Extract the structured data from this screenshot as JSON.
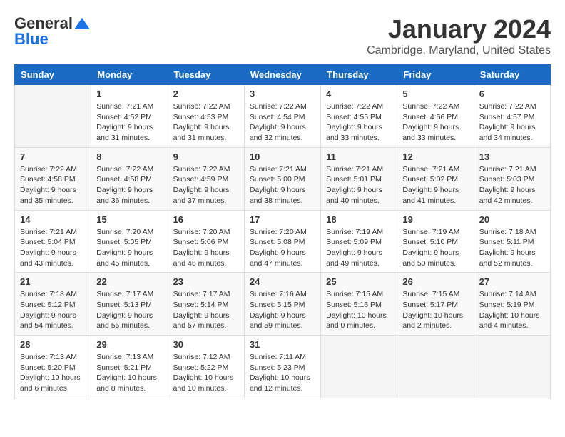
{
  "logo": {
    "line1": "General",
    "line2": "Blue",
    "bird_unicode": "▲"
  },
  "title": "January 2024",
  "subtitle": "Cambridge, Maryland, United States",
  "weekdays": [
    "Sunday",
    "Monday",
    "Tuesday",
    "Wednesday",
    "Thursday",
    "Friday",
    "Saturday"
  ],
  "weeks": [
    [
      {
        "day": "",
        "sunrise": "",
        "sunset": "",
        "daylight": ""
      },
      {
        "day": "1",
        "sunrise": "Sunrise: 7:21 AM",
        "sunset": "Sunset: 4:52 PM",
        "daylight": "Daylight: 9 hours and 31 minutes."
      },
      {
        "day": "2",
        "sunrise": "Sunrise: 7:22 AM",
        "sunset": "Sunset: 4:53 PM",
        "daylight": "Daylight: 9 hours and 31 minutes."
      },
      {
        "day": "3",
        "sunrise": "Sunrise: 7:22 AM",
        "sunset": "Sunset: 4:54 PM",
        "daylight": "Daylight: 9 hours and 32 minutes."
      },
      {
        "day": "4",
        "sunrise": "Sunrise: 7:22 AM",
        "sunset": "Sunset: 4:55 PM",
        "daylight": "Daylight: 9 hours and 33 minutes."
      },
      {
        "day": "5",
        "sunrise": "Sunrise: 7:22 AM",
        "sunset": "Sunset: 4:56 PM",
        "daylight": "Daylight: 9 hours and 33 minutes."
      },
      {
        "day": "6",
        "sunrise": "Sunrise: 7:22 AM",
        "sunset": "Sunset: 4:57 PM",
        "daylight": "Daylight: 9 hours and 34 minutes."
      }
    ],
    [
      {
        "day": "7",
        "sunrise": "Sunrise: 7:22 AM",
        "sunset": "Sunset: 4:58 PM",
        "daylight": "Daylight: 9 hours and 35 minutes."
      },
      {
        "day": "8",
        "sunrise": "Sunrise: 7:22 AM",
        "sunset": "Sunset: 4:58 PM",
        "daylight": "Daylight: 9 hours and 36 minutes."
      },
      {
        "day": "9",
        "sunrise": "Sunrise: 7:22 AM",
        "sunset": "Sunset: 4:59 PM",
        "daylight": "Daylight: 9 hours and 37 minutes."
      },
      {
        "day": "10",
        "sunrise": "Sunrise: 7:21 AM",
        "sunset": "Sunset: 5:00 PM",
        "daylight": "Daylight: 9 hours and 38 minutes."
      },
      {
        "day": "11",
        "sunrise": "Sunrise: 7:21 AM",
        "sunset": "Sunset: 5:01 PM",
        "daylight": "Daylight: 9 hours and 40 minutes."
      },
      {
        "day": "12",
        "sunrise": "Sunrise: 7:21 AM",
        "sunset": "Sunset: 5:02 PM",
        "daylight": "Daylight: 9 hours and 41 minutes."
      },
      {
        "day": "13",
        "sunrise": "Sunrise: 7:21 AM",
        "sunset": "Sunset: 5:03 PM",
        "daylight": "Daylight: 9 hours and 42 minutes."
      }
    ],
    [
      {
        "day": "14",
        "sunrise": "Sunrise: 7:21 AM",
        "sunset": "Sunset: 5:04 PM",
        "daylight": "Daylight: 9 hours and 43 minutes."
      },
      {
        "day": "15",
        "sunrise": "Sunrise: 7:20 AM",
        "sunset": "Sunset: 5:05 PM",
        "daylight": "Daylight: 9 hours and 45 minutes."
      },
      {
        "day": "16",
        "sunrise": "Sunrise: 7:20 AM",
        "sunset": "Sunset: 5:06 PM",
        "daylight": "Daylight: 9 hours and 46 minutes."
      },
      {
        "day": "17",
        "sunrise": "Sunrise: 7:20 AM",
        "sunset": "Sunset: 5:08 PM",
        "daylight": "Daylight: 9 hours and 47 minutes."
      },
      {
        "day": "18",
        "sunrise": "Sunrise: 7:19 AM",
        "sunset": "Sunset: 5:09 PM",
        "daylight": "Daylight: 9 hours and 49 minutes."
      },
      {
        "day": "19",
        "sunrise": "Sunrise: 7:19 AM",
        "sunset": "Sunset: 5:10 PM",
        "daylight": "Daylight: 9 hours and 50 minutes."
      },
      {
        "day": "20",
        "sunrise": "Sunrise: 7:18 AM",
        "sunset": "Sunset: 5:11 PM",
        "daylight": "Daylight: 9 hours and 52 minutes."
      }
    ],
    [
      {
        "day": "21",
        "sunrise": "Sunrise: 7:18 AM",
        "sunset": "Sunset: 5:12 PM",
        "daylight": "Daylight: 9 hours and 54 minutes."
      },
      {
        "day": "22",
        "sunrise": "Sunrise: 7:17 AM",
        "sunset": "Sunset: 5:13 PM",
        "daylight": "Daylight: 9 hours and 55 minutes."
      },
      {
        "day": "23",
        "sunrise": "Sunrise: 7:17 AM",
        "sunset": "Sunset: 5:14 PM",
        "daylight": "Daylight: 9 hours and 57 minutes."
      },
      {
        "day": "24",
        "sunrise": "Sunrise: 7:16 AM",
        "sunset": "Sunset: 5:15 PM",
        "daylight": "Daylight: 9 hours and 59 minutes."
      },
      {
        "day": "25",
        "sunrise": "Sunrise: 7:15 AM",
        "sunset": "Sunset: 5:16 PM",
        "daylight": "Daylight: 10 hours and 0 minutes."
      },
      {
        "day": "26",
        "sunrise": "Sunrise: 7:15 AM",
        "sunset": "Sunset: 5:17 PM",
        "daylight": "Daylight: 10 hours and 2 minutes."
      },
      {
        "day": "27",
        "sunrise": "Sunrise: 7:14 AM",
        "sunset": "Sunset: 5:19 PM",
        "daylight": "Daylight: 10 hours and 4 minutes."
      }
    ],
    [
      {
        "day": "28",
        "sunrise": "Sunrise: 7:13 AM",
        "sunset": "Sunset: 5:20 PM",
        "daylight": "Daylight: 10 hours and 6 minutes."
      },
      {
        "day": "29",
        "sunrise": "Sunrise: 7:13 AM",
        "sunset": "Sunset: 5:21 PM",
        "daylight": "Daylight: 10 hours and 8 minutes."
      },
      {
        "day": "30",
        "sunrise": "Sunrise: 7:12 AM",
        "sunset": "Sunset: 5:22 PM",
        "daylight": "Daylight: 10 hours and 10 minutes."
      },
      {
        "day": "31",
        "sunrise": "Sunrise: 7:11 AM",
        "sunset": "Sunset: 5:23 PM",
        "daylight": "Daylight: 10 hours and 12 minutes."
      },
      {
        "day": "",
        "sunrise": "",
        "sunset": "",
        "daylight": ""
      },
      {
        "day": "",
        "sunrise": "",
        "sunset": "",
        "daylight": ""
      },
      {
        "day": "",
        "sunrise": "",
        "sunset": "",
        "daylight": ""
      }
    ]
  ]
}
